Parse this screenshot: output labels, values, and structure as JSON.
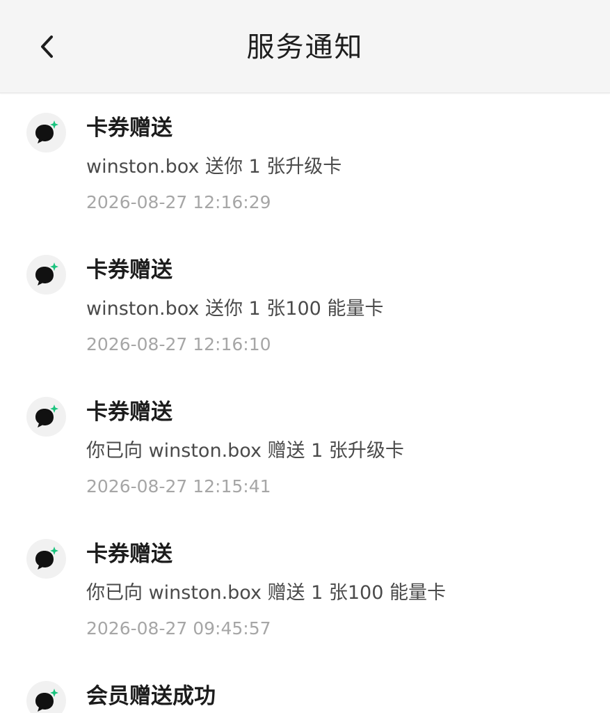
{
  "header": {
    "title": "服务通知",
    "back_icon": "chevron-left-icon"
  },
  "notifications": [
    {
      "icon": "chat-bubble-sparkle-icon",
      "title": "卡券赠送",
      "body": "winston.box 送你 1 张升级卡",
      "time": "2026-08-27 12:16:29"
    },
    {
      "icon": "chat-bubble-sparkle-icon",
      "title": "卡券赠送",
      "body": "winston.box 送你 1 张100 能量卡",
      "time": "2026-08-27 12:16:10"
    },
    {
      "icon": "chat-bubble-sparkle-icon",
      "title": "卡券赠送",
      "body": "你已向 winston.box 赠送 1 张升级卡",
      "time": "2026-08-27 12:15:41"
    },
    {
      "icon": "chat-bubble-sparkle-icon",
      "title": "卡券赠送",
      "body": "你已向 winston.box 赠送 1 张100 能量卡",
      "time": "2026-08-27 09:45:57"
    },
    {
      "icon": "chat-bubble-sparkle-icon",
      "title": "会员赠送成功"
    }
  ],
  "colors": {
    "header_bg": "#f5f5f5",
    "accent_green": "#19c37d",
    "icon_dark": "#111111",
    "timestamp": "#a6a6a6"
  }
}
